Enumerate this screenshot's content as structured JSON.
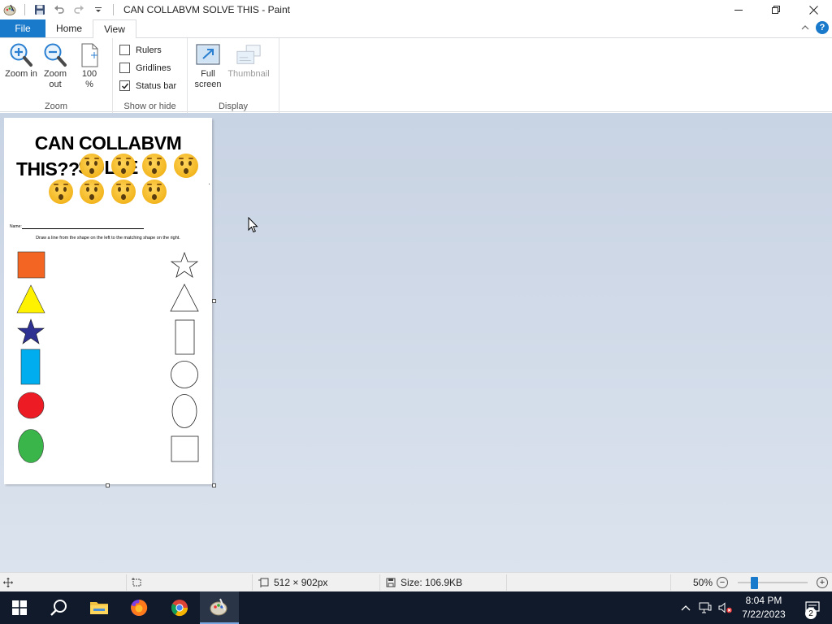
{
  "window": {
    "title": "CAN COLLABVM SOLVE THIS - Paint",
    "controls": [
      "minimize",
      "maximize",
      "close"
    ]
  },
  "ribbon_tabs": {
    "file": "File",
    "home": "Home",
    "view": "View",
    "active": "View"
  },
  "ribbon": {
    "zoom_group": {
      "label": "Zoom",
      "zoom_in": "Zoom in",
      "zoom_out": "Zoom out",
      "hundred": "100 %"
    },
    "show_hide_group": {
      "label": "Show or hide",
      "rulers": {
        "label": "Rulers",
        "checked": false
      },
      "gridlines": {
        "label": "Gridlines",
        "checked": false
      },
      "status_bar": {
        "label": "Status bar",
        "checked": true
      }
    },
    "display_group": {
      "label": "Display",
      "full_screen": "Full screen",
      "thumbnail": "Thumbnail"
    }
  },
  "canvas_doc": {
    "title_line1": "CAN COLLABVM SOLVE",
    "title_line2": "THIS??",
    "emoji_count": 8,
    "emoji_name": "hushed-face",
    "name_label": "Name:",
    "instruction": "Draw a line from the shape on the left to the matching shape on the right.",
    "left_shapes": [
      {
        "shape": "square",
        "color": "#f26522"
      },
      {
        "shape": "triangle",
        "color": "#fff200"
      },
      {
        "shape": "star",
        "color": "#2e3192"
      },
      {
        "shape": "rectangle",
        "color": "#00aeef"
      },
      {
        "shape": "circle",
        "color": "#ed1c24"
      },
      {
        "shape": "oval",
        "color": "#39b54a"
      }
    ],
    "right_shapes": [
      "star",
      "triangle",
      "rectangle",
      "circle",
      "oval",
      "square"
    ]
  },
  "statusbar": {
    "dimensions": "512 × 902px",
    "size": "Size: 106.9KB",
    "zoom": "50%",
    "zoom_value": 50
  },
  "taskbar": {
    "apps": [
      "start",
      "search",
      "file-explorer",
      "firefox",
      "chrome",
      "paint"
    ],
    "active_app": "paint",
    "time": "8:04 PM",
    "date": "7/22/2023",
    "notifications": "2"
  }
}
